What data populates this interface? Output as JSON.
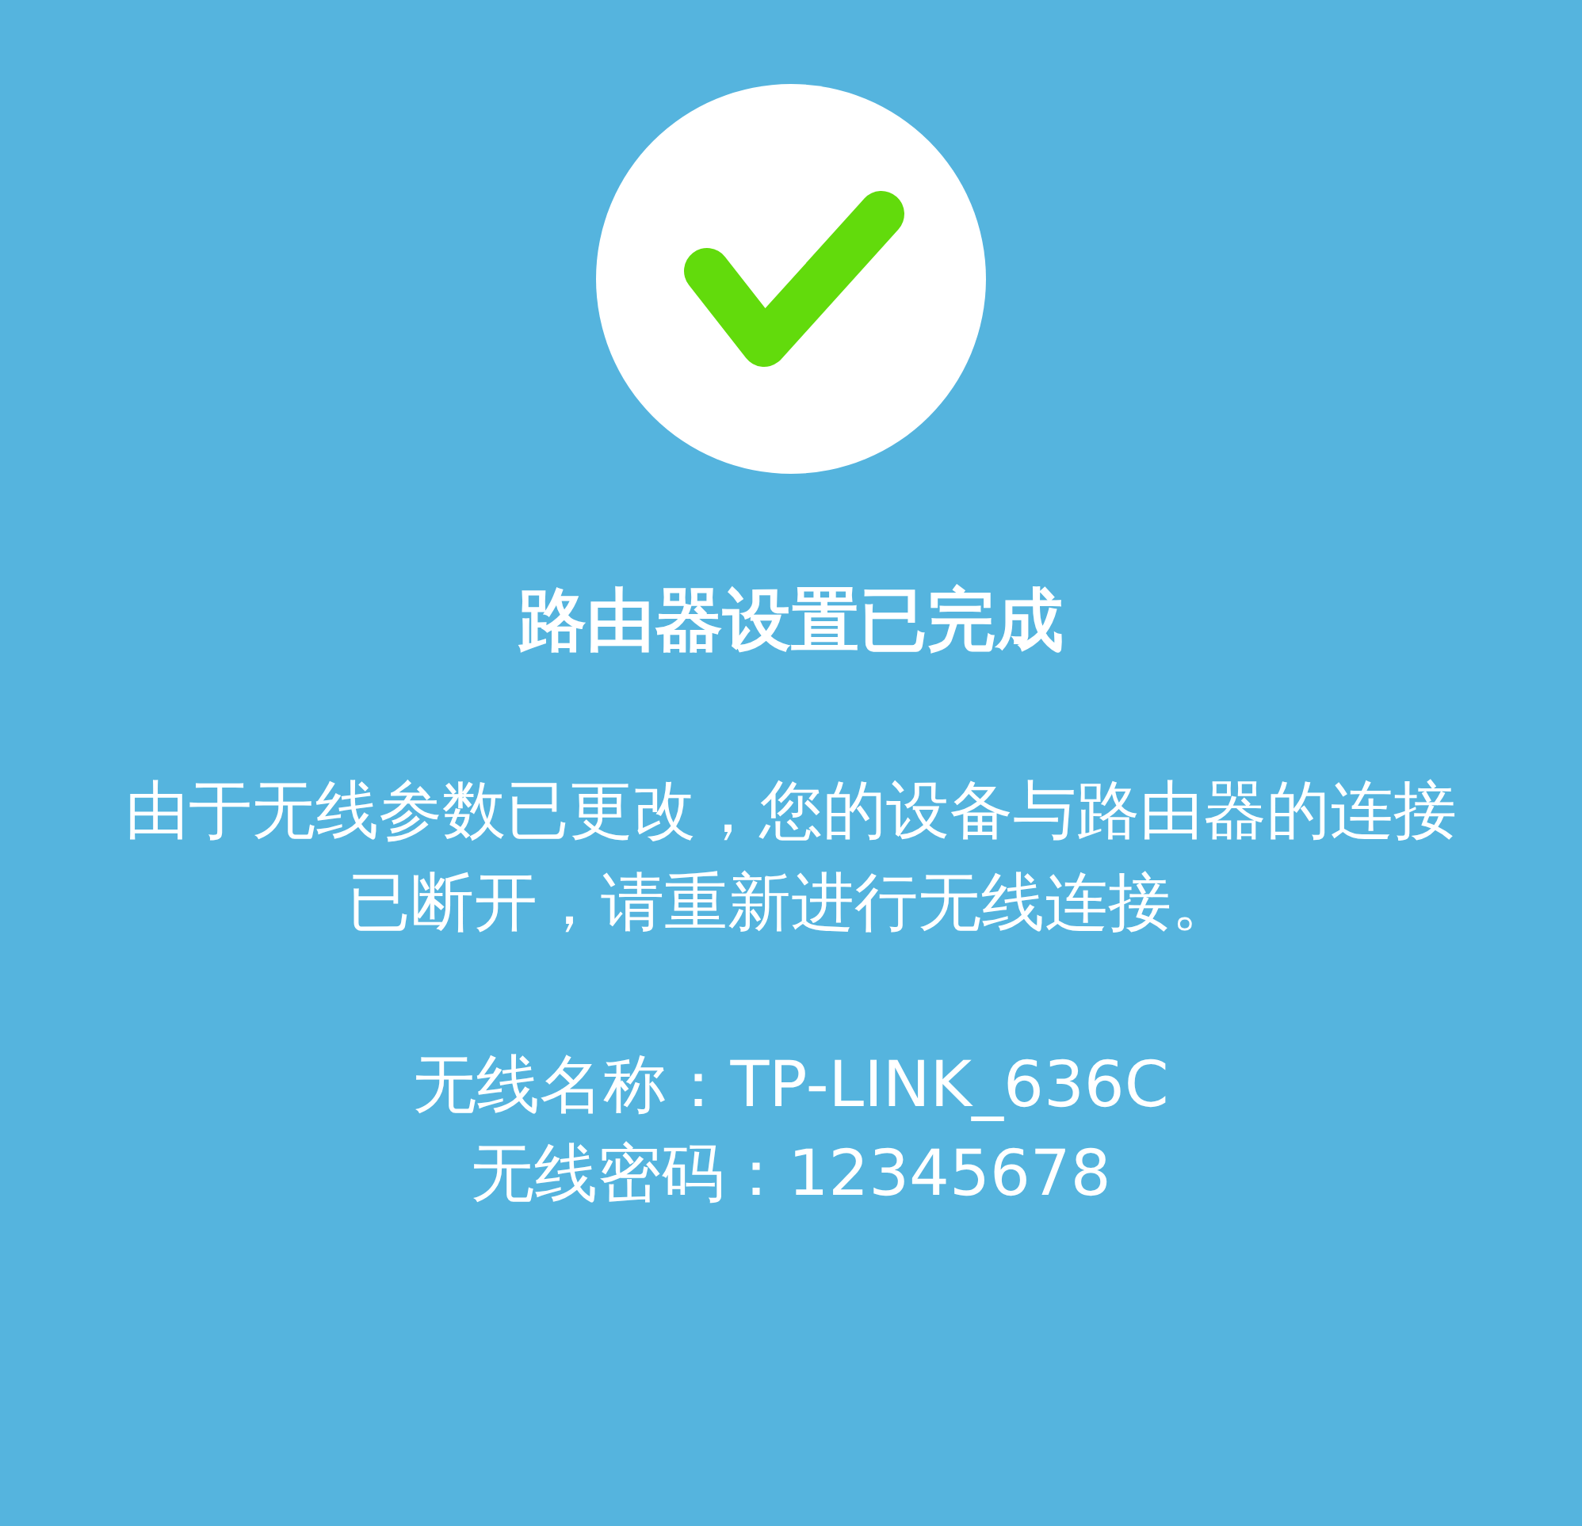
{
  "title": "路由器设置已完成",
  "message": "由于无线参数已更改，您的设备与路由器的连接已断开，请重新进行无线连接。",
  "wifi_info": [
    {
      "label": "无线名称：",
      "value": "TP-LINK_636C"
    },
    {
      "label": "无线密码：",
      "value": "12345678"
    }
  ]
}
